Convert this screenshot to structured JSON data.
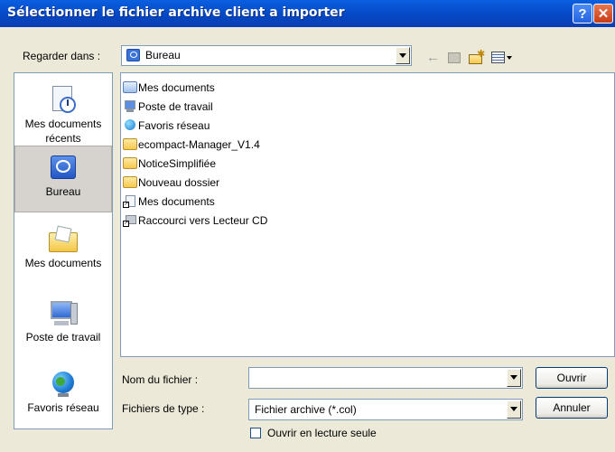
{
  "window": {
    "title": "Sélectionner le fichier archive client a importer",
    "help_label": "?",
    "close_label": "✕"
  },
  "lookin": {
    "label": "Regarder dans :",
    "value": "Bureau"
  },
  "places": [
    {
      "label": "Mes documents récents",
      "icon": "recent-documents-icon"
    },
    {
      "label": "Bureau",
      "icon": "desktop-icon",
      "selected": true
    },
    {
      "label": "Mes documents",
      "icon": "my-documents-icon"
    },
    {
      "label": "Poste de travail",
      "icon": "my-computer-icon"
    },
    {
      "label": "Favoris réseau",
      "icon": "network-places-icon"
    }
  ],
  "files": [
    {
      "name": "Mes documents",
      "icon": "documents-folder-icon"
    },
    {
      "name": "Poste de travail",
      "icon": "computer-icon"
    },
    {
      "name": "Favoris réseau",
      "icon": "network-icon"
    },
    {
      "name": "ecompact-Manager_V1.4",
      "icon": "folder-icon"
    },
    {
      "name": "NoticeSimplifiée",
      "icon": "folder-icon"
    },
    {
      "name": "Nouveau dossier",
      "icon": "folder-icon"
    },
    {
      "name": "Mes documents",
      "icon": "shortcut-icon"
    },
    {
      "name": "Raccourci vers Lecteur CD",
      "icon": "cd-shortcut-icon"
    }
  ],
  "filename": {
    "label": "Nom du fichier :",
    "value": ""
  },
  "filetype": {
    "label": "Fichiers de type :",
    "value": "Fichier archive (*.col)"
  },
  "readonly": {
    "label": "Ouvrir en lecture seule",
    "checked": false
  },
  "buttons": {
    "open": "Ouvrir",
    "cancel": "Annuler"
  }
}
